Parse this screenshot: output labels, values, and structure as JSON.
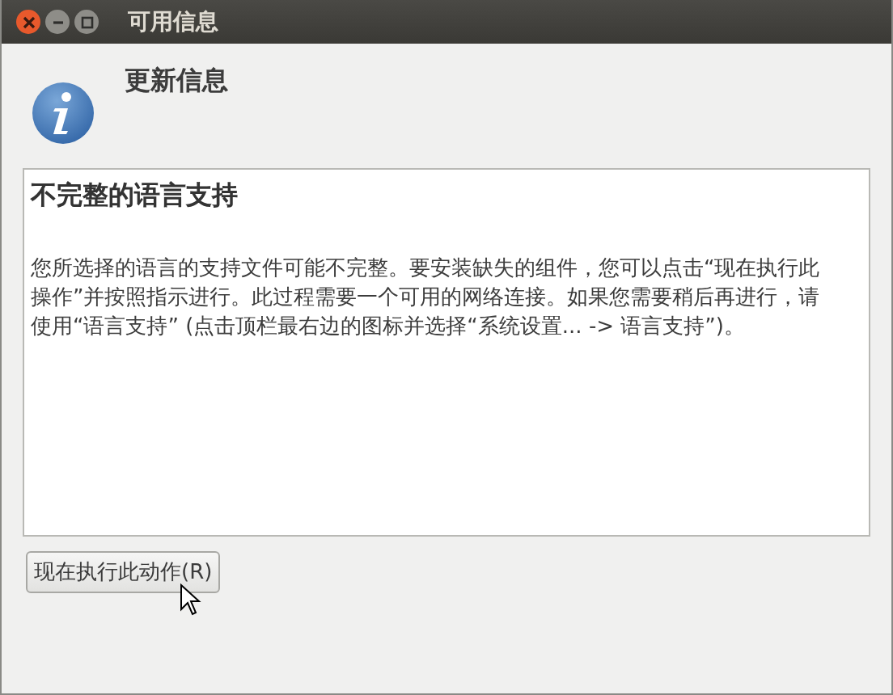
{
  "window": {
    "title": "可用信息"
  },
  "header": {
    "title": "更新信息"
  },
  "message": {
    "heading": "不完整的语言支持",
    "body": "您所选择的语言的支持文件可能不完整。要安装缺失的组件，您可以点击“现在执行此操作”并按照指示进行。此过程需要一个可用的网络连接。如果您需要稍后再进行，请使用“语言支持” (点击顶栏最右边的图标并选择“系统设置... -> 语言支持”)。"
  },
  "buttons": [
    {
      "label": "现在执行此动作(R)"
    }
  ]
}
